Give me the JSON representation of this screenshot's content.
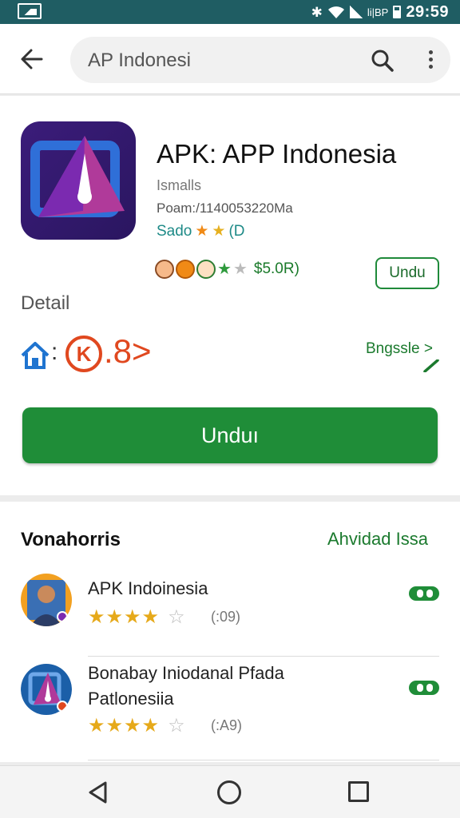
{
  "status_bar": {
    "time": "29:59",
    "carrier": "li|BP",
    "icons": [
      "gallery-icon",
      "bluetooth-icon",
      "wifi-icon",
      "signal-icon",
      "battery-icon"
    ]
  },
  "top_bar": {
    "search_value": "AP Indonesi",
    "icons": [
      "back-arrow-icon",
      "search-icon",
      "more-vert-icon"
    ]
  },
  "app": {
    "title": "APK: APP Indonesia",
    "subtitle": "Ismalls",
    "meta": "Poam:/1140053220Ma",
    "rating_label": "Sado",
    "rating_suffix": "(D",
    "price": "$5.0R)",
    "small_install_label": "Undu",
    "detail_label": "Detail",
    "colon": ":",
    "k_glyph": "K",
    "big_value": ".8˃",
    "side_link": "Bngssle >",
    "install_label": "Unduı",
    "icon_colors": {
      "accent": "#e0481f",
      "brand_green": "#1f8d38",
      "icon_bg": "#3b1c7a"
    }
  },
  "related": {
    "title": "Vonahorris",
    "more_label": "Ahvidad Issa",
    "items": [
      {
        "name_line1": "APK Indoinesia",
        "name_line2": "",
        "rating": 3.5,
        "stars_text": "★★★★",
        "star_off": "☆",
        "count": "(:09)"
      },
      {
        "name_line1": "Bonabay Iniodanal Pfada",
        "name_line2": "Patlonesiia",
        "rating": 4,
        "stars_text": "★★★★",
        "star_off": "☆",
        "count": "(:A9)"
      }
    ]
  },
  "nav_bar": {
    "icons": [
      "nav-back-icon",
      "nav-home-icon",
      "nav-recent-icon"
    ]
  }
}
